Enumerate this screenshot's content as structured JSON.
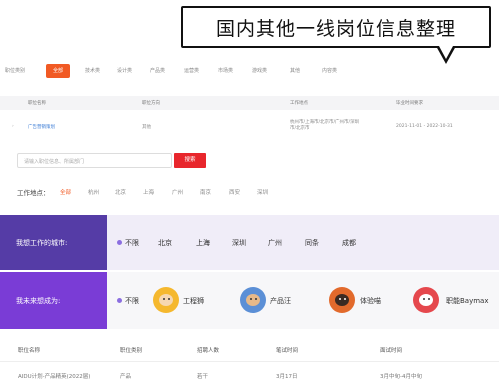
{
  "callout": {
    "text": "国内其他一线岗位信息整理"
  },
  "categories": [
    "职位类别",
    "全部",
    "技术类",
    "设计类",
    "产品类",
    "运营类",
    "市场类",
    "游戏类",
    "其他",
    "内容类"
  ],
  "job_table": {
    "headers": [
      "职位名称",
      "职位方向",
      "工作地点",
      "毕业时间要求"
    ],
    "rows": [
      {
        "name": "广告营销策划",
        "direction": "其他",
        "location": "杭州市/上海市/北京市/广州市/深圳市/北京市",
        "graduation": "2021-11-01 - 2022-10-31"
      }
    ]
  },
  "search": {
    "placeholder": "请输入职位信息、所属部门",
    "button": "搜索"
  },
  "work_location": {
    "label": "工作地点：",
    "options": [
      "全部",
      "杭州",
      "北京",
      "上海",
      "广州",
      "南京",
      "西安",
      "深圳"
    ],
    "selected": "全部"
  },
  "city_filter": {
    "label": "我想工作的城市:",
    "options": [
      "不限",
      "北京",
      "上海",
      "深圳",
      "广州",
      "同条",
      "成都"
    ],
    "selected": "上海"
  },
  "role_filter": {
    "label": "我未来想成为:",
    "options": [
      "不限",
      "工程狮",
      "产品汪",
      "体验喵",
      "职能Baymax"
    ]
  },
  "bottom_table": {
    "headers": [
      "职位名称",
      "职位类别",
      "招聘人数",
      "笔试时间",
      "面试时间"
    ],
    "rows": [
      {
        "name": "AIDU计划-产品精英(2022届)",
        "category": "产品",
        "count": "若干",
        "written": "3月17日",
        "interview": "3月中旬-4月中旬"
      }
    ]
  },
  "colors": {
    "accent": "#f15a24",
    "search_button": "#e8262c",
    "banner_dark": "#553ca6",
    "banner_light": "#7a3cd6"
  },
  "icons": [
    "lion-avatar-icon",
    "dog-avatar-icon",
    "cat-avatar-icon",
    "robot-avatar-icon"
  ]
}
